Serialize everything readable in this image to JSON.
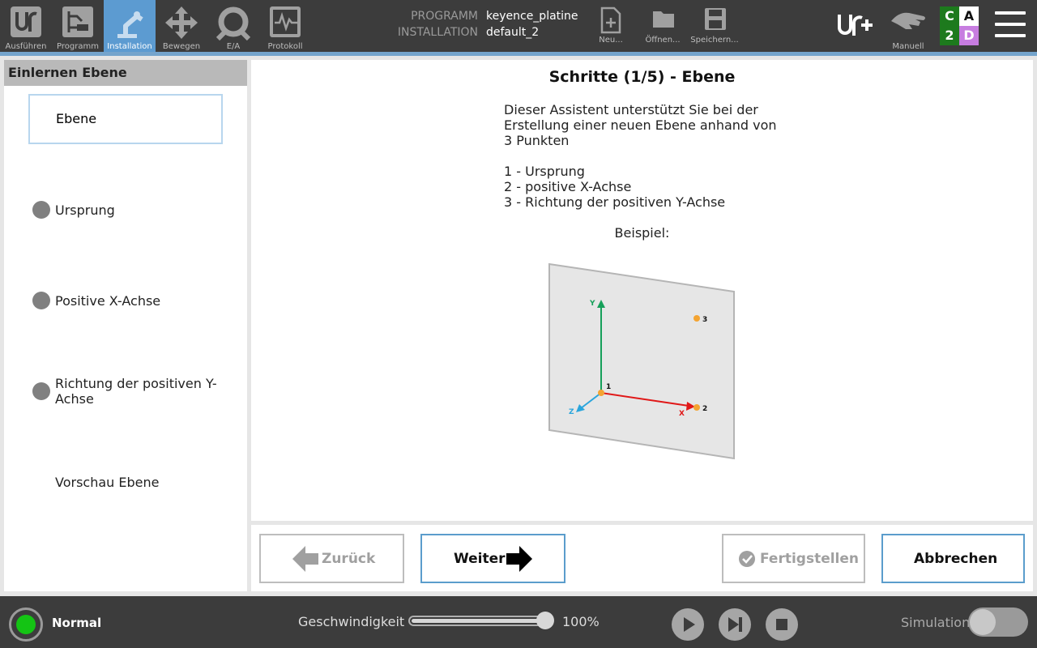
{
  "header": {
    "nav": [
      {
        "label": "Ausführen",
        "icon": "ur-logo-icon"
      },
      {
        "label": "Programm",
        "icon": "program-tree-icon"
      },
      {
        "label": "Installation",
        "icon": "robot-arm-icon"
      },
      {
        "label": "Bewegen",
        "icon": "move-arrows-icon"
      },
      {
        "label": "E/A",
        "icon": "io-icon"
      },
      {
        "label": "Protokoll",
        "icon": "log-icon"
      }
    ],
    "program_key": "PROGRAMM",
    "program_value": "keyence_platine",
    "installation_key": "INSTALLATION",
    "installation_value": "default_2",
    "file_actions": [
      {
        "label": "Neu...",
        "icon": "new-file-icon"
      },
      {
        "label": "Öffnen...",
        "icon": "open-folder-icon"
      },
      {
        "label": "Speichern...",
        "icon": "save-icon"
      }
    ],
    "mode_label": "Manuell",
    "cad": {
      "c": "C",
      "a": "A",
      "two": "2",
      "d": "D"
    },
    "colors": {
      "bar": "#3c3c3c",
      "active": "#5c9bd1",
      "accent_line": "#74a4cc"
    }
  },
  "wizard": {
    "panel_title": "Einlernen Ebene",
    "steps": [
      {
        "label": "Ebene",
        "has_dot": false
      },
      {
        "label": "Ursprung",
        "has_dot": true
      },
      {
        "label": "Positive X-Achse",
        "has_dot": true
      },
      {
        "label": "Richtung der positiven Y-Achse",
        "has_dot": true
      },
      {
        "label": "Vorschau Ebene",
        "has_dot": false
      }
    ],
    "title": "Schritte (1/5) - Ebene",
    "description": "Dieser Assistent unterstützt Sie bei der\nErstellung einer neuen Ebene anhand von\n3 Punkten",
    "point_list": [
      "1 - Ursprung",
      "2 - positive X-Achse",
      "3 - Richtung der positiven Y-Achse"
    ],
    "example_label": "Beispiel:",
    "diagram": {
      "y": "Y",
      "x": "X",
      "z": "Z",
      "p1": "1",
      "p2": "2",
      "p3": "3"
    }
  },
  "actions": {
    "back": "Zurück",
    "next": "Weiter",
    "finish": "Fertigstellen",
    "cancel": "Abbrechen"
  },
  "footer": {
    "status": "Normal",
    "speed_label": "Geschwindigkeit",
    "speed_value": "100%",
    "speed_fraction": 1.0,
    "simulation_label": "Simulation",
    "simulation_on": false
  }
}
